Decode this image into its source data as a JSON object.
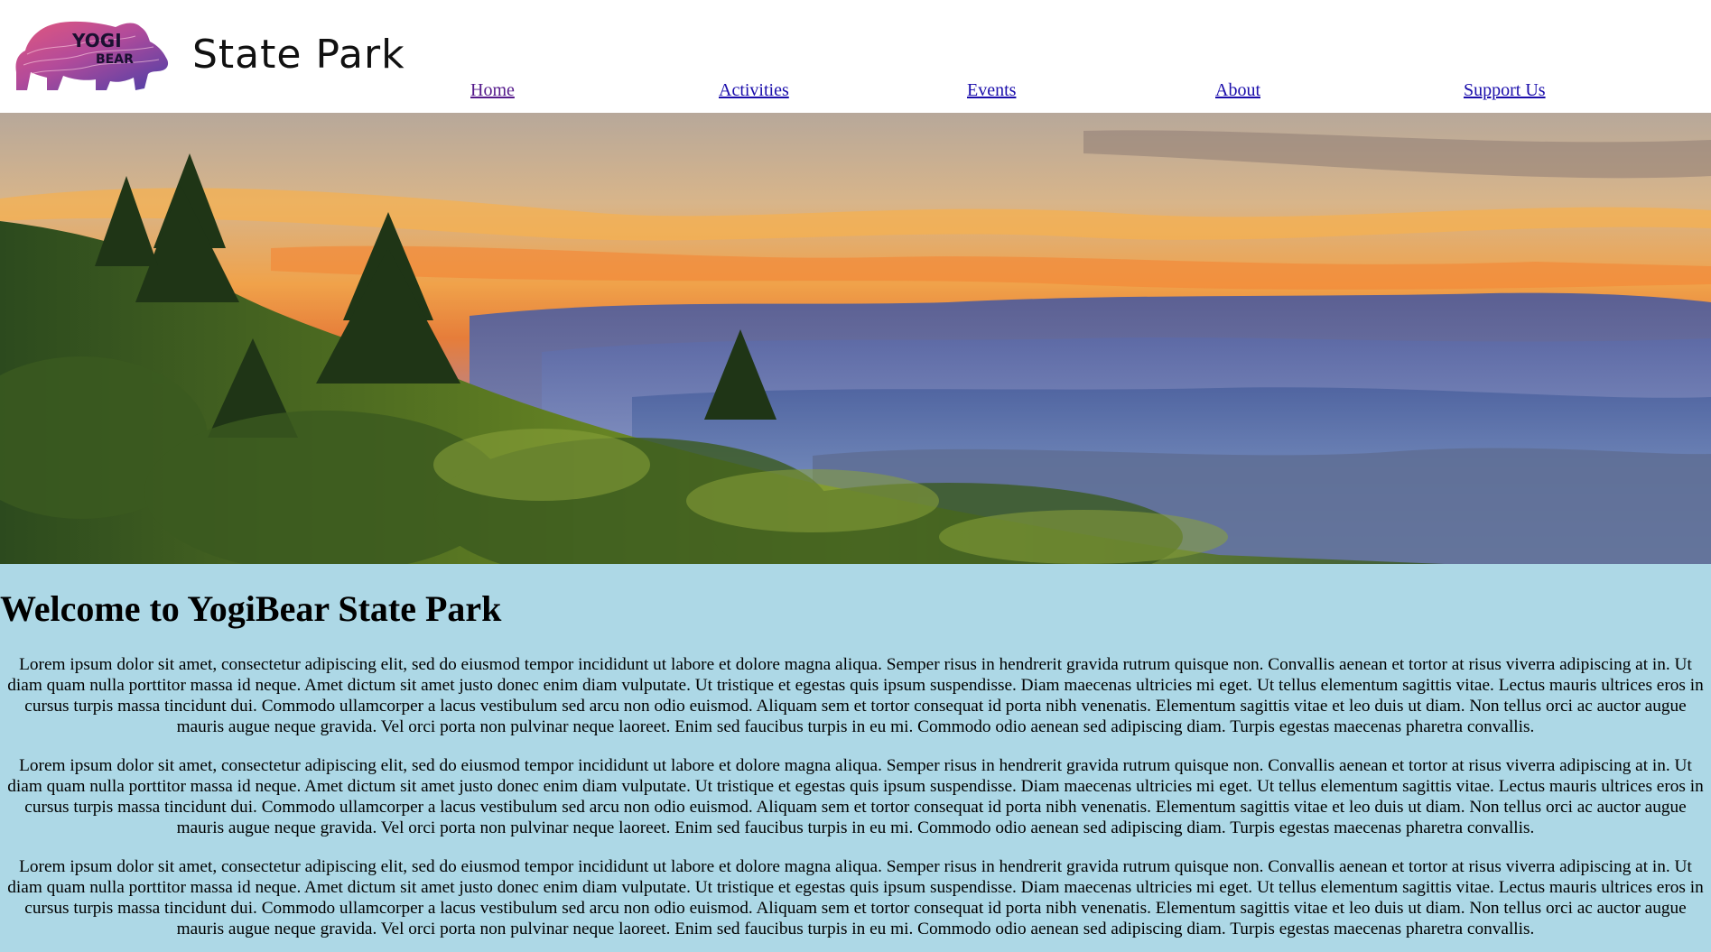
{
  "header": {
    "logo_text_line1": "YOGI",
    "logo_text_line2": "BEAR",
    "site_title": "State Park"
  },
  "nav": {
    "items": [
      {
        "label": "Home"
      },
      {
        "label": "Activities"
      },
      {
        "label": "Events"
      },
      {
        "label": "About"
      },
      {
        "label": "Support Us"
      }
    ]
  },
  "hero": {
    "icon": "mountain-sunset-photo"
  },
  "main": {
    "heading": "Welcome to YogiBear State Park",
    "paragraphs": [
      "Lorem ipsum dolor sit amet, consectetur adipiscing elit, sed do eiusmod tempor incididunt ut labore et dolore magna aliqua. Semper risus in hendrerit gravida rutrum quisque non. Convallis aenean et tortor at risus viverra adipiscing at in. Ut diam quam nulla porttitor massa id neque. Amet dictum sit amet justo donec enim diam vulputate. Ut tristique et egestas quis ipsum suspendisse. Diam maecenas ultricies mi eget. Ut tellus elementum sagittis vitae. Lectus mauris ultrices eros in cursus turpis massa tincidunt dui. Commodo ullamcorper a lacus vestibulum sed arcu non odio euismod. Aliquam sem et tortor consequat id porta nibh venenatis. Elementum sagittis vitae et leo duis ut diam. Non tellus orci ac auctor augue mauris augue neque gravida. Vel orci porta non pulvinar neque laoreet. Enim sed faucibus turpis in eu mi. Commodo odio aenean sed adipiscing diam. Turpis egestas maecenas pharetra convallis.",
      "Lorem ipsum dolor sit amet, consectetur adipiscing elit, sed do eiusmod tempor incididunt ut labore et dolore magna aliqua. Semper risus in hendrerit gravida rutrum quisque non. Convallis aenean et tortor at risus viverra adipiscing at in. Ut diam quam nulla porttitor massa id neque. Amet dictum sit amet justo donec enim diam vulputate. Ut tristique et egestas quis ipsum suspendisse. Diam maecenas ultricies mi eget. Ut tellus elementum sagittis vitae. Lectus mauris ultrices eros in cursus turpis massa tincidunt dui. Commodo ullamcorper a lacus vestibulum sed arcu non odio euismod. Aliquam sem et tortor consequat id porta nibh venenatis. Elementum sagittis vitae et leo duis ut diam. Non tellus orci ac auctor augue mauris augue neque gravida. Vel orci porta non pulvinar neque laoreet. Enim sed faucibus turpis in eu mi. Commodo odio aenean sed adipiscing diam. Turpis egestas maecenas pharetra convallis.",
      "Lorem ipsum dolor sit amet, consectetur adipiscing elit, sed do eiusmod tempor incididunt ut labore et dolore magna aliqua. Semper risus in hendrerit gravida rutrum quisque non. Convallis aenean et tortor at risus viverra adipiscing at in. Ut diam quam nulla porttitor massa id neque. Amet dictum sit amet justo donec enim diam vulputate. Ut tristique et egestas quis ipsum suspendisse. Diam maecenas ultricies mi eget. Ut tellus elementum sagittis vitae. Lectus mauris ultrices eros in cursus turpis massa tincidunt dui. Commodo ullamcorper a lacus vestibulum sed arcu non odio euismod. Aliquam sem et tortor consequat id porta nibh venenatis. Elementum sagittis vitae et leo duis ut diam. Non tellus orci ac auctor augue mauris augue neque gravida. Vel orci porta non pulvinar neque laoreet. Enim sed faucibus turpis in eu mi. Commodo odio aenean sed adipiscing diam. Turpis egestas maecenas pharetra convallis."
    ]
  }
}
